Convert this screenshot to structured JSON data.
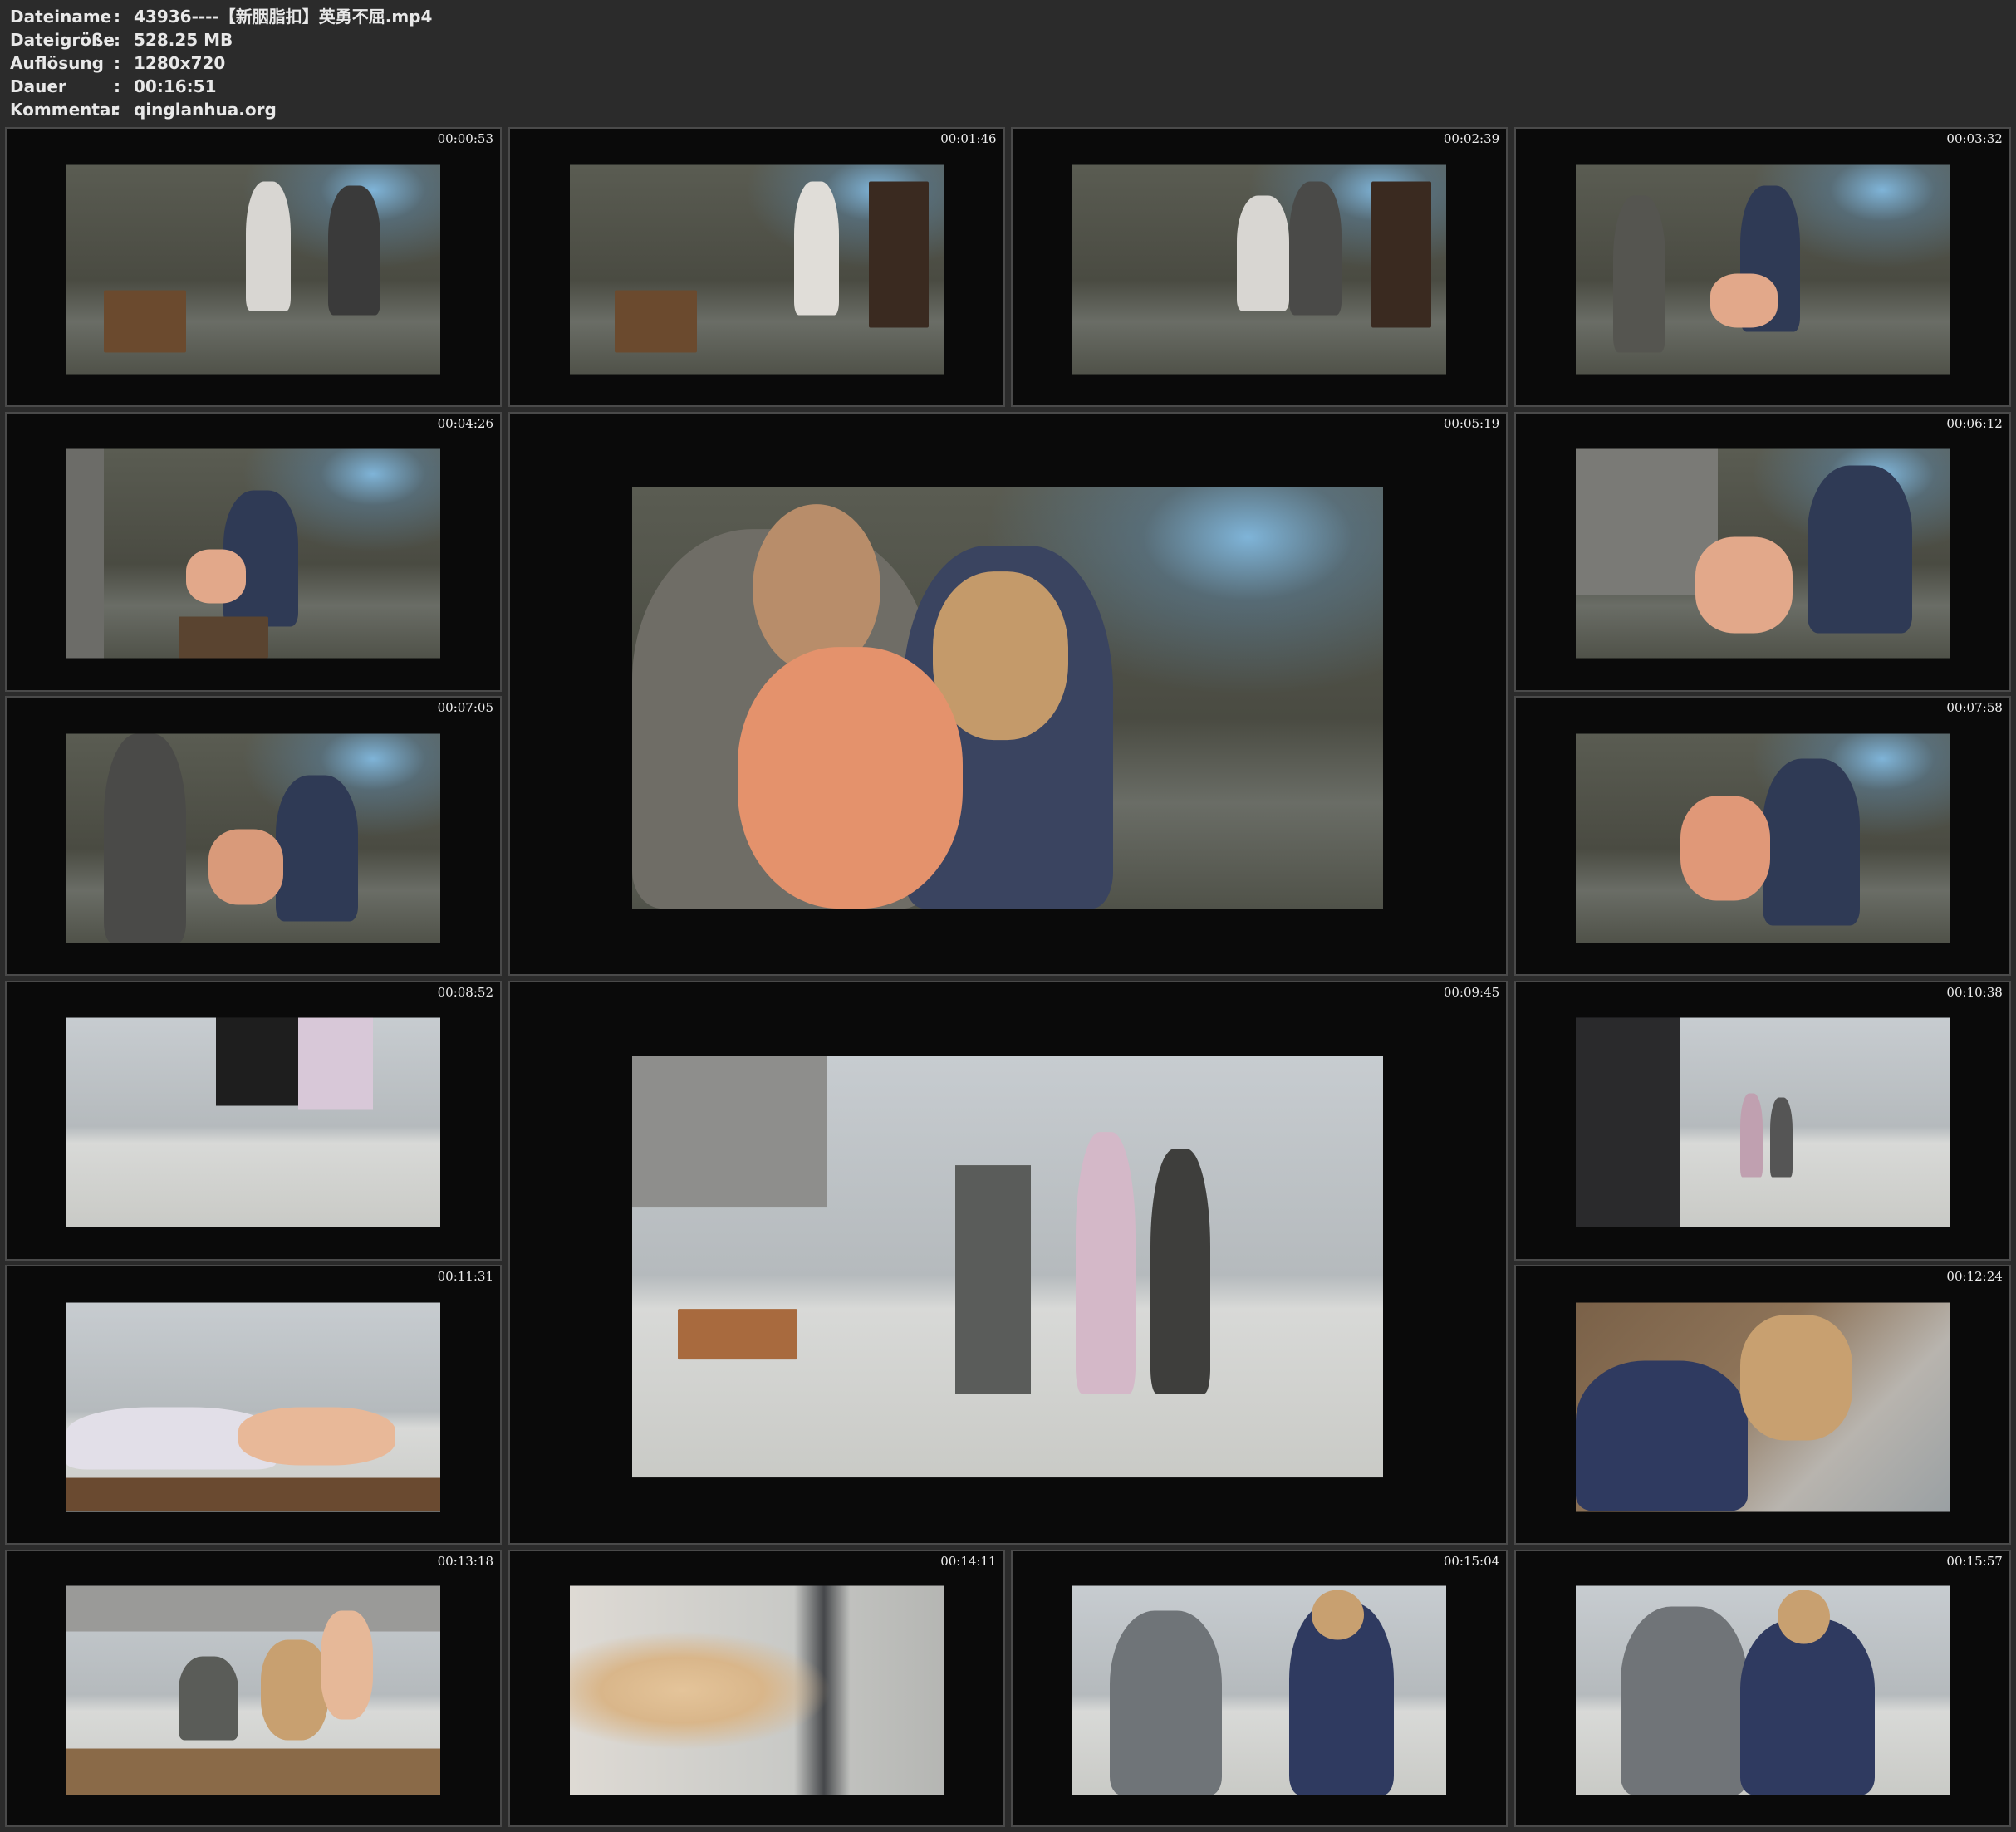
{
  "info": [
    {
      "label": "Dateiname",
      "value": "43936----【新胭脂扣】英勇不屈.mp4"
    },
    {
      "label": "Dateigröße",
      "value": "528.25 MB"
    },
    {
      "label": "Auflösung",
      "value": "1280x720"
    },
    {
      "label": "Dauer",
      "value": "00:16:51"
    },
    {
      "label": "Kommentar",
      "value": "qinglanhua.org"
    }
  ],
  "separator": ":",
  "thumbnails": [
    {
      "time": "00:00:53"
    },
    {
      "time": "00:01:46"
    },
    {
      "time": "00:02:39"
    },
    {
      "time": "00:03:32"
    },
    {
      "time": "00:04:26"
    },
    {
      "time": "00:05:19"
    },
    {
      "time": "00:06:12"
    },
    {
      "time": "00:07:05"
    },
    {
      "time": "00:07:58"
    },
    {
      "time": "00:08:52"
    },
    {
      "time": "00:09:45"
    },
    {
      "time": "00:10:38"
    },
    {
      "time": "00:11:31"
    },
    {
      "time": "00:12:24"
    },
    {
      "time": "00:13:18"
    },
    {
      "time": "00:14:11"
    },
    {
      "time": "00:15:04"
    },
    {
      "time": "00:15:57"
    }
  ]
}
